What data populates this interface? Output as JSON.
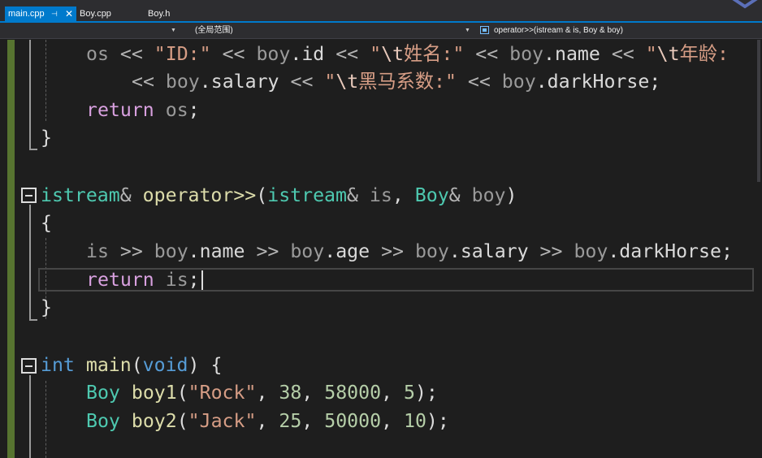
{
  "tabs": [
    {
      "label": "main.cpp",
      "active": true,
      "pin_glyph": "⊣",
      "close_glyph": "✕"
    },
    {
      "label": "Boy.cpp",
      "active": false
    },
    {
      "label": "Boy.h",
      "active": false
    }
  ],
  "navbar": {
    "project": "",
    "scope": "(全局范围)",
    "member": "operator>>(istream & is, Boy & boy)"
  },
  "code": {
    "line1": {
      "os": "os",
      "lshift": "<<",
      "str_id": "\"ID:\"",
      "boy": "boy",
      "dot": ".",
      "id": "id",
      "str_name_open": "\"",
      "esc_t": "\\t",
      "str_name_text": "姓名:\"",
      "name": "name",
      "str_age_open": "\"",
      "str_age_text": "年龄:"
    },
    "line2": {
      "lshift": "<<",
      "boy": "boy",
      "dot": ".",
      "salary": "salary",
      "str_dh_open": "\"",
      "esc_t": "\\t",
      "str_dh_text": "黑马系数:\"",
      "darkHorse": "darkHorse",
      "semi": ";"
    },
    "line3": {
      "return": "return",
      "os": "os",
      "semi": ";"
    },
    "line4": {
      "close": "}"
    },
    "line5": {
      "istream": "istream",
      "amp": "&",
      "operator": "operator>>",
      "lparen": "(",
      "istream2": "istream",
      "amp2": "&",
      "is": "is",
      "comma": ",",
      "Boy": "Boy",
      "amp3": "&",
      "boy": "boy",
      "rparen": ")"
    },
    "line6": {
      "open": "{"
    },
    "line7": {
      "is": "is",
      "rshift": ">>",
      "boy": "boy",
      "dot": ".",
      "name": "name",
      "age": "age",
      "salary": "salary",
      "darkHorse": "darkHorse",
      "semi": ";"
    },
    "line8": {
      "return": "return",
      "is": "is",
      "semi": ";"
    },
    "line9": {
      "close": "}"
    },
    "line10": {
      "int": "int",
      "main": "main",
      "lparen": "(",
      "void": "void",
      "rparen": ")",
      "open": "{"
    },
    "line11": {
      "Boy": "Boy",
      "var": "boy1",
      "lparen": "(",
      "str": "\"Rock\"",
      "comma": ",",
      "n1": "38",
      "n2": "58000",
      "n3": "5",
      "rparen": ")",
      "semi": ";"
    },
    "line12": {
      "Boy": "Boy",
      "var": "boy2",
      "lparen": "(",
      "str": "\"Jack\"",
      "comma": ",",
      "n1": "25",
      "n2": "50000",
      "n3": "10",
      "rparen": ")",
      "semi": ";"
    }
  },
  "colors": {
    "editor_bg": "#1e1e1e",
    "accent": "#007acc",
    "keyword": "#569cd6",
    "control_keyword": "#d8a0df",
    "type": "#4ec9b0",
    "function": "#dcdcaa",
    "string": "#d69d85",
    "number": "#b5cea8",
    "parameter": "#9cdcfe",
    "change_bar": "#577430"
  },
  "icons": {
    "pin": "pin-icon",
    "close": "close-icon",
    "member": "method-icon",
    "fold": "collapse-icon",
    "logo": "visual-studio-logo-icon"
  }
}
